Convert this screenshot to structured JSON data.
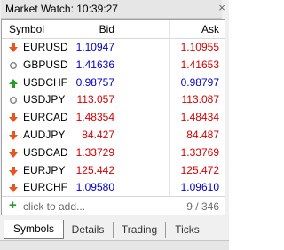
{
  "window": {
    "title": "Market Watch: 10:39:27",
    "close_glyph": "×"
  },
  "columns": {
    "symbol": "Symbol",
    "bid": "Bid",
    "ask": "Ask"
  },
  "rows": [
    {
      "symbol": "EURUSD",
      "bid": "1.10947",
      "ask": "1.10955",
      "icon": "arrow-down-icon",
      "bid_color": "blue",
      "ask_color": "red"
    },
    {
      "symbol": "GBPUSD",
      "bid": "1.41636",
      "ask": "1.41653",
      "icon": "circle-icon",
      "bid_color": "blue",
      "ask_color": "red"
    },
    {
      "symbol": "USDCHF",
      "bid": "0.98757",
      "ask": "0.98797",
      "icon": "arrow-up-icon",
      "bid_color": "blue",
      "ask_color": "blue"
    },
    {
      "symbol": "USDJPY",
      "bid": "113.057",
      "ask": "113.087",
      "icon": "circle-icon",
      "bid_color": "red",
      "ask_color": "red"
    },
    {
      "symbol": "EURCAD",
      "bid": "1.48354",
      "ask": "1.48434",
      "icon": "arrow-down-icon",
      "bid_color": "red",
      "ask_color": "red"
    },
    {
      "symbol": "AUDJPY",
      "bid": "84.427",
      "ask": "84.487",
      "icon": "arrow-down-icon",
      "bid_color": "red",
      "ask_color": "red"
    },
    {
      "symbol": "USDCAD",
      "bid": "1.33729",
      "ask": "1.33769",
      "icon": "arrow-down-icon",
      "bid_color": "red",
      "ask_color": "red"
    },
    {
      "symbol": "EURJPY",
      "bid": "125.442",
      "ask": "125.472",
      "icon": "arrow-down-icon",
      "bid_color": "red",
      "ask_color": "red"
    },
    {
      "symbol": "EURCHF",
      "bid": "1.09580",
      "ask": "1.09610",
      "icon": "arrow-down-icon",
      "bid_color": "blue",
      "ask_color": "blue"
    }
  ],
  "footer": {
    "add_label": "click to add...",
    "count": "9 / 346",
    "icon": "plus-icon"
  },
  "tabs": [
    {
      "label": "Symbols",
      "active": true
    },
    {
      "label": "Details",
      "active": false
    },
    {
      "label": "Trading",
      "active": false
    },
    {
      "label": "Ticks",
      "active": false
    }
  ],
  "colors": {
    "blue": "#0000c8",
    "red": "#d70000",
    "arrow_down": "#e8541e",
    "arrow_up": "#23a023",
    "circle": "#8e8e8e"
  }
}
